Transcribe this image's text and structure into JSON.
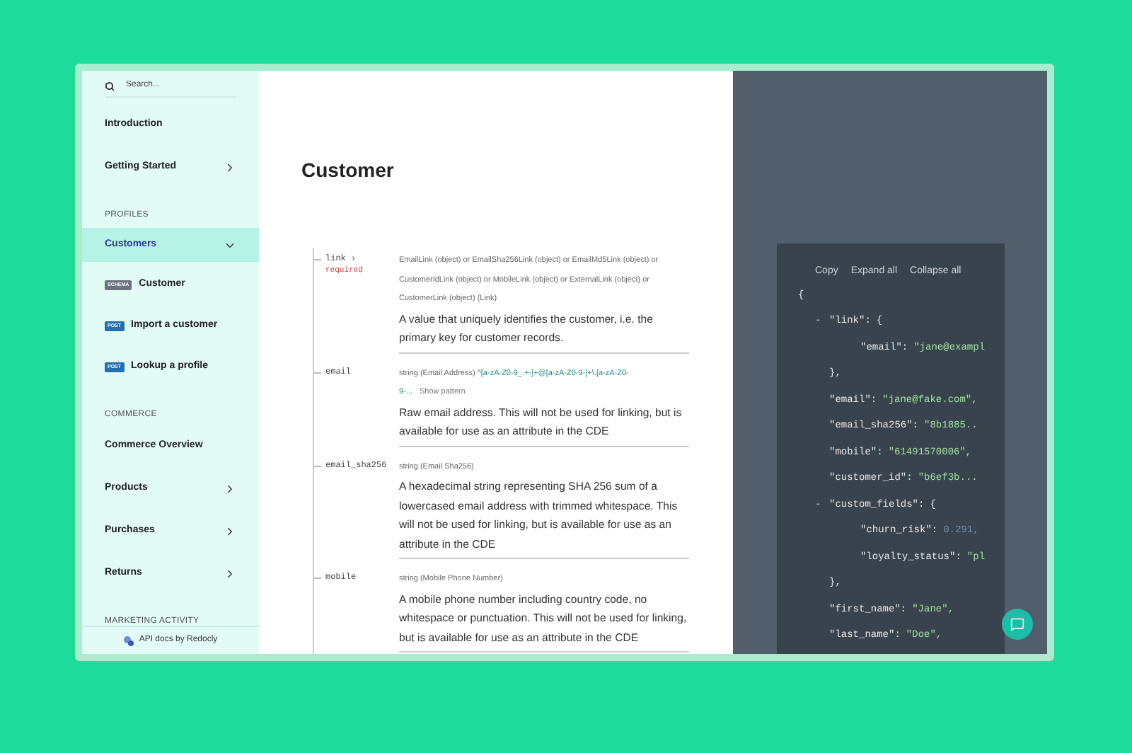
{
  "sidebar": {
    "search": {
      "placeholder": "Search..."
    },
    "items": [
      {
        "kind": "link",
        "label": "Introduction"
      },
      {
        "kind": "group",
        "label": "Getting Started",
        "expanded": false
      },
      {
        "kind": "section",
        "label": "PROFILES"
      },
      {
        "kind": "group",
        "label": "Customers",
        "expanded": true,
        "selected": true
      },
      {
        "kind": "operation",
        "badge": "SCHEMA",
        "color": "#6b7280",
        "label": "Customer"
      },
      {
        "kind": "operation",
        "badge": "POST",
        "color": "#1f6fb2",
        "label": "Import a customer"
      },
      {
        "kind": "operation",
        "badge": "POST",
        "color": "#1f6fb2",
        "label": "Lookup a profile"
      },
      {
        "kind": "section",
        "label": "COMMERCE"
      },
      {
        "kind": "link",
        "label": "Commerce Overview"
      },
      {
        "kind": "group",
        "label": "Products",
        "expanded": false
      },
      {
        "kind": "group",
        "label": "Purchases",
        "expanded": false
      },
      {
        "kind": "group",
        "label": "Returns",
        "expanded": false
      },
      {
        "kind": "section",
        "label": "MARKETING ACTIVITY"
      }
    ],
    "footer": "API docs by Redocly"
  },
  "content": {
    "title": "Customer",
    "fields": [
      {
        "name": "link",
        "chevron": "›",
        "required": "required",
        "type": "EmailLink (object) or EmailSha256Link (object) or EmailMd5Link (object) or CustomerIdLink (object) or MobileLink (object) or ExternalLink (object) or CustomerLink (object) (Link)",
        "description": "A value that uniquely identifies the customer, i.e. the primary key for customer records."
      },
      {
        "name": "email",
        "type": "string (Email Address)",
        "pattern": "^[a-zA-Z0-9_.+-]+@[a-zA-Z0-9-]+\\.[a-zA-Z0-9-...",
        "show_pattern": "Show pattern",
        "description": "Raw email address. This will not be used for linking, but is available for use as an attribute in the CDE"
      },
      {
        "name": "email_sha256",
        "type": "string (Email Sha256)",
        "description": "A hexadecimal string representing SHA 256 sum of a lowercased email address with trimmed whitespace. This will not be used for linking, but is available for use as an attribute in the CDE"
      },
      {
        "name": "mobile",
        "type": "string (Mobile Phone Number)",
        "description": "A mobile phone number including country code, no whitespace or punctuation. This will not be used for linking, but is available for use as an attribute in the CDE"
      }
    ]
  },
  "sample": {
    "buttons": [
      "Copy",
      "Expand all",
      "Collapse all"
    ],
    "root": {
      "open": "{",
      "children": [
        {
          "toggle": "-",
          "key": "\"link\":",
          "open": "{",
          "close": "},",
          "children": [
            {
              "key": "\"email\":",
              "value": "\"jane@exampl",
              "kind": "string"
            }
          ]
        },
        {
          "key": "\"email\":",
          "value": "\"jane@fake.com\",",
          "kind": "string"
        },
        {
          "key": "\"email_sha256\":",
          "value": "\"8b1885..",
          "kind": "string"
        },
        {
          "key": "\"mobile\":",
          "value": "\"61491570006\",",
          "kind": "string"
        },
        {
          "key": "\"customer_id\":",
          "value": "\"b6ef3b...",
          "kind": "string"
        },
        {
          "toggle": "-",
          "key": "\"custom_fields\":",
          "open": "{",
          "close": "},",
          "children": [
            {
              "key": "\"churn_risk\":",
              "value": "0.291,",
              "kind": "number"
            },
            {
              "key": "\"loyalty_status\":",
              "value": "\"pl",
              "kind": "string"
            }
          ]
        },
        {
          "key": "\"first_name\":",
          "value": "\"Jane\",",
          "kind": "string"
        },
        {
          "key": "\"last_name\":",
          "value": "\"Doe\",",
          "kind": "string"
        }
      ]
    }
  }
}
